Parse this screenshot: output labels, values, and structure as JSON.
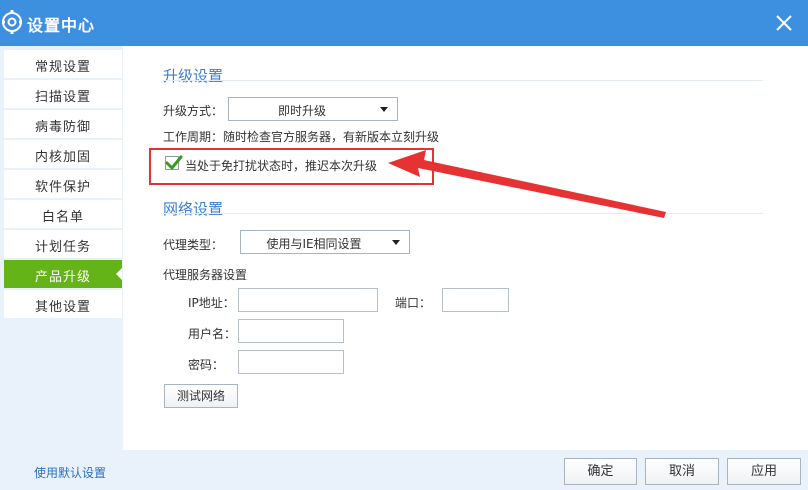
{
  "window": {
    "title": "设置中心",
    "logo_icon": "gear-logo-icon",
    "close_icon": "close-icon"
  },
  "sidebar": {
    "items": [
      {
        "label": "常规设置",
        "active": false
      },
      {
        "label": "扫描设置",
        "active": false
      },
      {
        "label": "病毒防御",
        "active": false
      },
      {
        "label": "内核加固",
        "active": false
      },
      {
        "label": "软件保护",
        "active": false
      },
      {
        "label": "白名单",
        "active": false
      },
      {
        "label": "计划任务",
        "active": false
      },
      {
        "label": "产品升级",
        "active": true
      },
      {
        "label": "其他设置",
        "active": false
      }
    ]
  },
  "upgrade": {
    "section_title": "升级设置",
    "mode_label": "升级方式：",
    "mode_value": "即时升级",
    "schedule_text": "工作周期：随时检查官方服务器，有新版本立刻升级",
    "defer_checkbox_label": "当处于免打扰状态时，推迟本次升级",
    "defer_checked": true
  },
  "network": {
    "section_title": "网络设置",
    "proxy_type_label": "代理类型：",
    "proxy_type_value": "使用与IE相同设置",
    "proxy_server_label": "代理服务器设置",
    "ip_label": "IP地址：",
    "ip_value": "",
    "port_label": "端口：",
    "port_value": "",
    "username_label": "用户名：",
    "username_value": "",
    "password_label": "密码：",
    "password_value": "",
    "test_button": "测试网络"
  },
  "footer": {
    "default_link": "使用默认设置",
    "ok_button": "确定",
    "cancel_button": "取消",
    "apply_button": "应用"
  },
  "colors": {
    "titlebar": "#3d8fe0",
    "active_nav": "#63b319",
    "section_title": "#3d7fcf",
    "annotation_red": "#e63232"
  }
}
